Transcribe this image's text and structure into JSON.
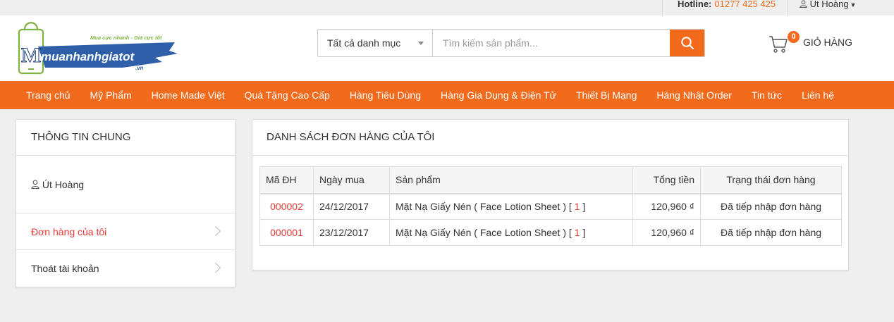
{
  "topbar": {
    "hotline_label": "Hotline:",
    "hotline_number": "01277 425 425",
    "user_name": "Út Hoàng"
  },
  "header": {
    "logo_tagline": "Mua cực nhanh - Giá cực tốt",
    "logo_text": "muanhanhgiatot",
    "logo_domain": ".vn",
    "search": {
      "category": "Tất cả danh mục",
      "placeholder": "Tìm kiếm sản phẩm..."
    },
    "cart": {
      "count": "0",
      "label": "GIỎ HÀNG"
    }
  },
  "nav": {
    "items": [
      "Trang chủ",
      "Mỹ Phẩm",
      "Home Made Việt",
      "Quà Tặng Cao Cấp",
      "Hàng Tiêu Dùng",
      "Hàng Gia Dụng & Điện Tử",
      "Thiết Bị Mạng",
      "Hàng Nhật Order",
      "Tin tức",
      "Liên hệ"
    ]
  },
  "sidebar": {
    "title": "THÔNG TIN CHUNG",
    "user": "Út Hoàng",
    "items": [
      "Đơn hàng của tôi",
      "Thoát tài khoản"
    ]
  },
  "orders": {
    "title": "DANH SÁCH ĐƠN HÀNG CỦA TÔI",
    "columns": [
      "Mã ĐH",
      "Ngày mua",
      "Sản phẩm",
      "Tổng tiền",
      "Trạng thái đơn hàng"
    ],
    "rows": [
      {
        "id": "000002",
        "date": "24/12/2017",
        "product": "Mặt Nạ Giấy Nén ( Face Lotion Sheet )",
        "qty": "1",
        "total": "120,960 ₫",
        "status": "Đã tiếp nhập đơn hàng"
      },
      {
        "id": "000001",
        "date": "23/12/2017",
        "product": "Mặt Nạ Giấy Nén ( Face Lotion Sheet )",
        "qty": "1",
        "total": "120,960 ₫",
        "status": "Đã tiếp nhập đơn hàng"
      }
    ]
  },
  "colors": {
    "accent": "#f26b1d",
    "link_red": "#e53935"
  }
}
